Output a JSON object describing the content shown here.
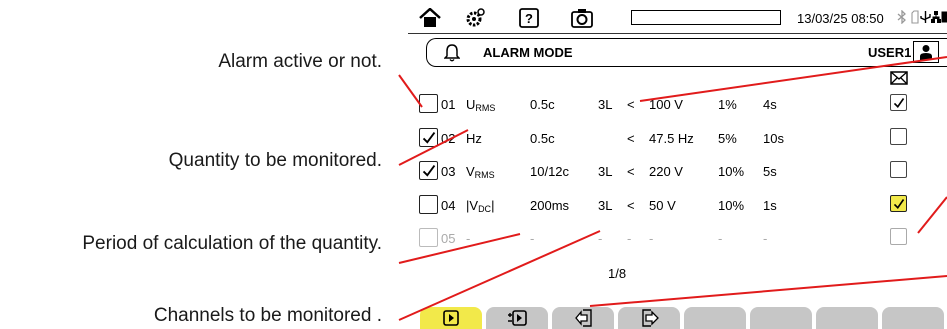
{
  "callouts": [
    "Alarm active or not.",
    "Quantity to be monitored.",
    "Period of calculation of the quantity.",
    "Channels to be monitored ."
  ],
  "status_bar": {
    "datetime": "13/03/25 08:50",
    "icons": [
      "home-icon",
      "gear-icon",
      "help-icon",
      "camera-icon",
      "bluetooth-icon",
      "sd-card-icon",
      "usb-icon",
      "network-icon",
      "battery-icon"
    ]
  },
  "title_bar": {
    "title": "ALARM MODE",
    "user": "USER1",
    "icons": [
      "bell-icon",
      "user-icon"
    ]
  },
  "table": {
    "mail_column_icon": "envelope-icon",
    "rows": [
      {
        "num": "01",
        "qty": "U",
        "qty_sub": "RMS",
        "period": "0.5c",
        "channels": "3L",
        "op": "<",
        "threshold": "100 V",
        "hysteresis": "1%",
        "duration": "4s",
        "active": false,
        "mail": true,
        "mail_highlight": false,
        "enabled": true
      },
      {
        "num": "02",
        "qty": "Hz",
        "qty_sub": "",
        "period": "0.5c",
        "channels": "",
        "op": "<",
        "threshold": "47.5 Hz",
        "hysteresis": "5%",
        "duration": "10s",
        "active": true,
        "mail": false,
        "mail_highlight": false,
        "enabled": true
      },
      {
        "num": "03",
        "qty": "V",
        "qty_sub": "RMS",
        "period": "10/12c",
        "channels": "3L",
        "op": "<",
        "threshold": "220 V",
        "hysteresis": "10%",
        "duration": "5s",
        "active": true,
        "mail": false,
        "mail_highlight": false,
        "enabled": true
      },
      {
        "num": "04",
        "qty": "|V",
        "qty_sub": "DC",
        "qty_suffix": "|",
        "period": "200ms",
        "channels": "3L",
        "op": "<",
        "threshold": "50 V",
        "hysteresis": "10%",
        "duration": "1s",
        "active": false,
        "mail": true,
        "mail_highlight": true,
        "enabled": true
      },
      {
        "num": "05",
        "qty": "-",
        "qty_sub": "",
        "period": "-",
        "channels": "-",
        "op": "-",
        "threshold": "-",
        "hysteresis": "-",
        "duration": "-",
        "active": false,
        "mail": false,
        "mail_highlight": false,
        "enabled": false
      }
    ]
  },
  "page_indicator": "1/8",
  "tabs": [
    {
      "icon": "play-icon",
      "active": true
    },
    {
      "icon": "play-mode-icon",
      "active": false
    },
    {
      "icon": "import-icon",
      "active": false
    },
    {
      "icon": "export-icon",
      "active": false
    },
    {
      "icon": "",
      "active": false
    },
    {
      "icon": "",
      "active": false
    },
    {
      "icon": "",
      "active": false
    },
    {
      "icon": "",
      "active": false
    }
  ],
  "colors": {
    "accent_yellow": "#f2e94a",
    "tab_gray": "#c6c6c6",
    "callout_line": "#e11b1b"
  }
}
